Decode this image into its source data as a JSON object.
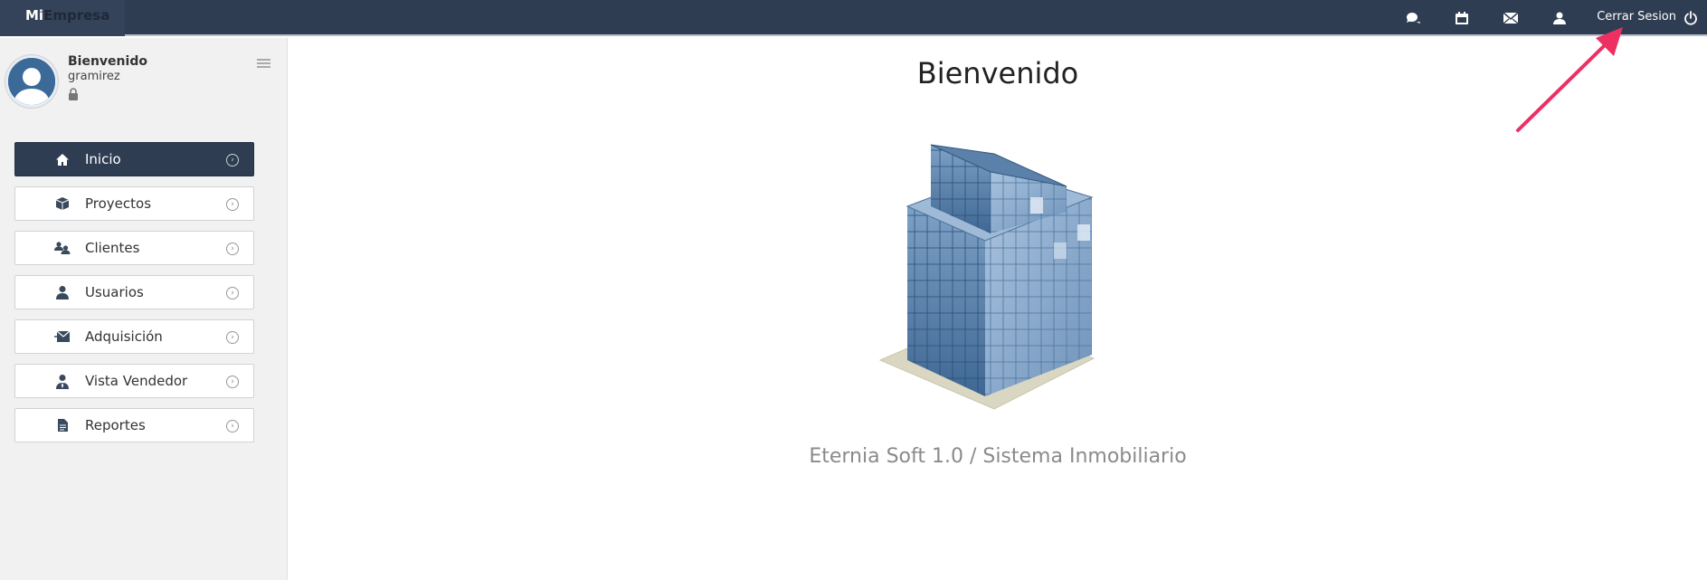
{
  "brand": {
    "part1": "Mi",
    "part2": "Empresa"
  },
  "topbar": {
    "icons": [
      "chat-icon",
      "calendar-icon",
      "envelope-icon",
      "user-icon"
    ],
    "logout_label": "Cerrar Sesion",
    "logout_icon": "power-icon"
  },
  "sidebar": {
    "welcome": "Bienvenido",
    "username": "gramirez",
    "items": [
      {
        "label": "Inicio",
        "icon": "home-icon",
        "active": true
      },
      {
        "label": "Proyectos",
        "icon": "box-icon",
        "active": false
      },
      {
        "label": "Clientes",
        "icon": "users-icon",
        "active": false
      },
      {
        "label": "Usuarios",
        "icon": "user-icon",
        "active": false
      },
      {
        "label": "Adquisición",
        "icon": "envelope-arrow-icon",
        "active": false
      },
      {
        "label": "Vista Vendedor",
        "icon": "salesperson-icon",
        "active": false
      },
      {
        "label": "Reportes",
        "icon": "document-icon",
        "active": false
      }
    ]
  },
  "main": {
    "title": "Bienvenido",
    "tagline": "Eternia Soft 1.0 / Sistema Inmobiliario"
  },
  "colors": {
    "topbar": "#2f3d52",
    "active_item": "#2f3d52",
    "annotation_arrow": "#ee2f62"
  }
}
